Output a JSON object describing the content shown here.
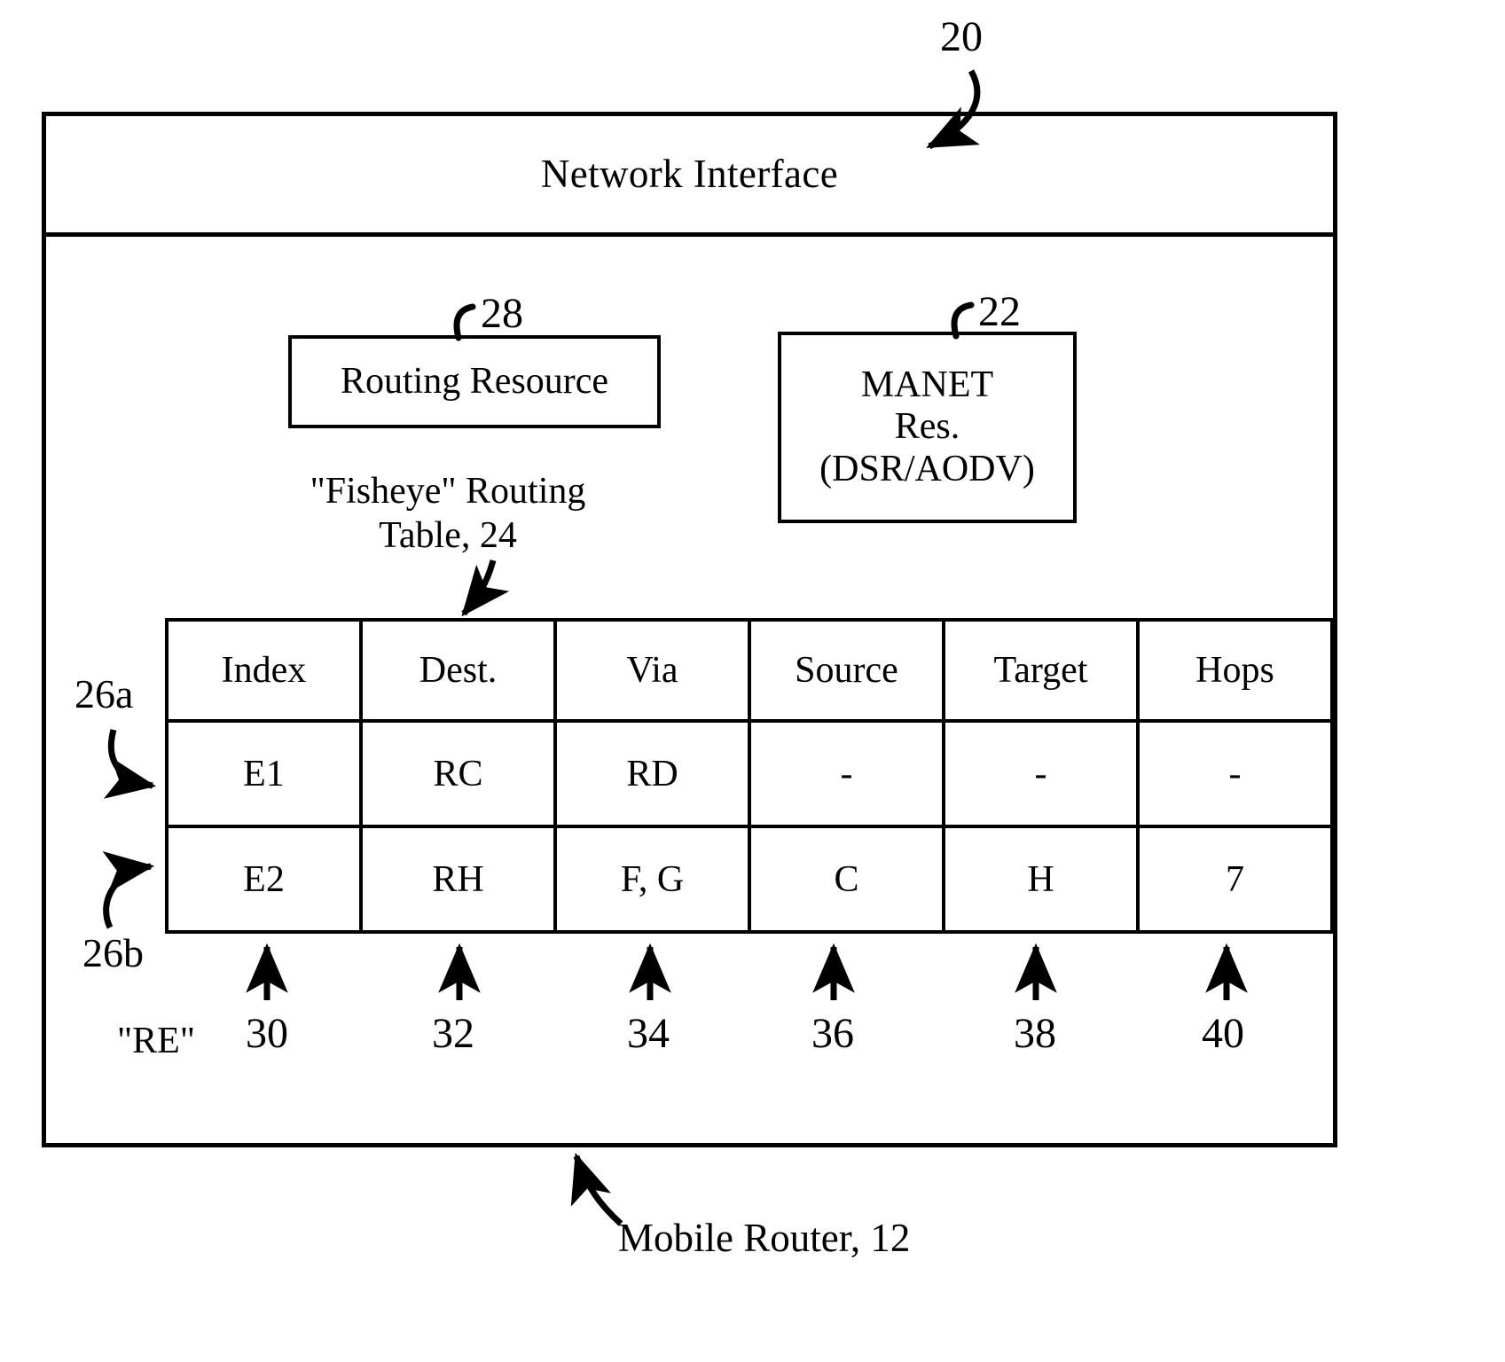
{
  "figure": {
    "outer_label": "20",
    "network_interface": "Network Interface",
    "caption_bottom": "Mobile Router, 12",
    "re_label": "\"RE\""
  },
  "blocks": [
    {
      "name": "routing-resource",
      "text": "Routing Resource",
      "ref": "28"
    },
    {
      "name": "manet-resource",
      "text": "MANET\nRes.\n(DSR/AODV)",
      "ref": "22"
    }
  ],
  "routing_resource": {
    "label": "Routing Resource",
    "ref": "28"
  },
  "manet": {
    "line1": "MANET",
    "line2": "Res.",
    "line3": "(DSR/AODV)",
    "ref": "22"
  },
  "table_caption": {
    "line1": "\"Fisheye\" Routing",
    "line2": "Table, 24",
    "ref": "24"
  },
  "table": {
    "headers": [
      "Index",
      "Dest.",
      "Via",
      "Source",
      "Target",
      "Hops"
    ],
    "column_refs": [
      "30",
      "32",
      "34",
      "36",
      "38",
      "40"
    ],
    "row_refs": [
      "26a",
      "26b"
    ],
    "rows": [
      [
        "E1",
        "RC",
        "RD",
        "-",
        "-",
        "-"
      ],
      [
        "E2",
        "RH",
        "F, G",
        "C",
        "H",
        "7"
      ]
    ]
  },
  "colors": {
    "ink": "#000000",
    "paper": "#ffffff"
  }
}
